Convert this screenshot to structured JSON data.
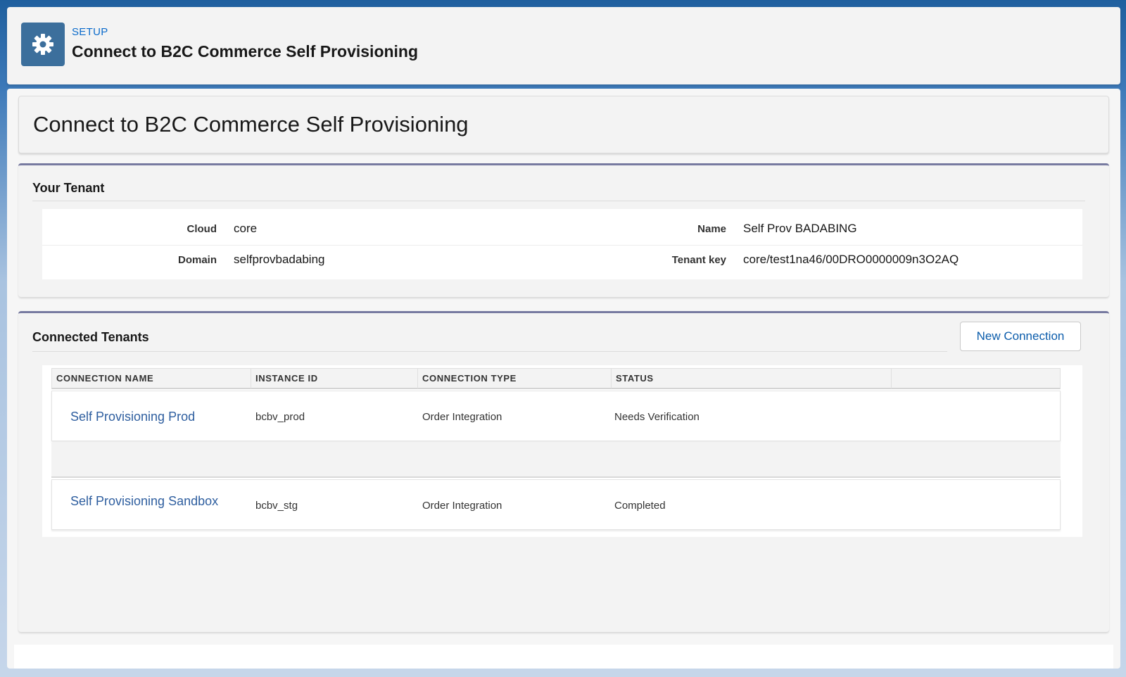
{
  "header": {
    "eyebrow": "SETUP",
    "title": "Connect to B2C Commerce Self Provisioning",
    "icon": "gear-icon"
  },
  "page": {
    "title": "Connect to B2C Commerce Self Provisioning"
  },
  "tenant": {
    "section_title": "Your Tenant",
    "fields": [
      {
        "label": "Cloud",
        "value": "core"
      },
      {
        "label": "Domain",
        "value": "selfprovbadabing"
      },
      {
        "label": "Name",
        "value": "Self Prov BADABING"
      },
      {
        "label": "Tenant key",
        "value": "core/test1na46/00DRO0000009n3O2AQ"
      }
    ]
  },
  "connected": {
    "section_title": "Connected Tenants",
    "new_button": "New Connection",
    "columns": [
      "CONNECTION NAME",
      "INSTANCE ID",
      "CONNECTION TYPE",
      "STATUS"
    ],
    "rows": [
      {
        "name": "Self Provisioning Prod",
        "instance_id": "bcbv_prod",
        "type": "Order Integration",
        "status": "Needs Verification"
      },
      {
        "name": "Self Provisioning Sandbox",
        "instance_id": "bcbv_stg",
        "type": "Order Integration",
        "status": "Completed"
      }
    ]
  },
  "colors": {
    "link": "#2e5e9f",
    "icon_bg": "#3c6f9c",
    "section_accent": "#777aa0"
  }
}
